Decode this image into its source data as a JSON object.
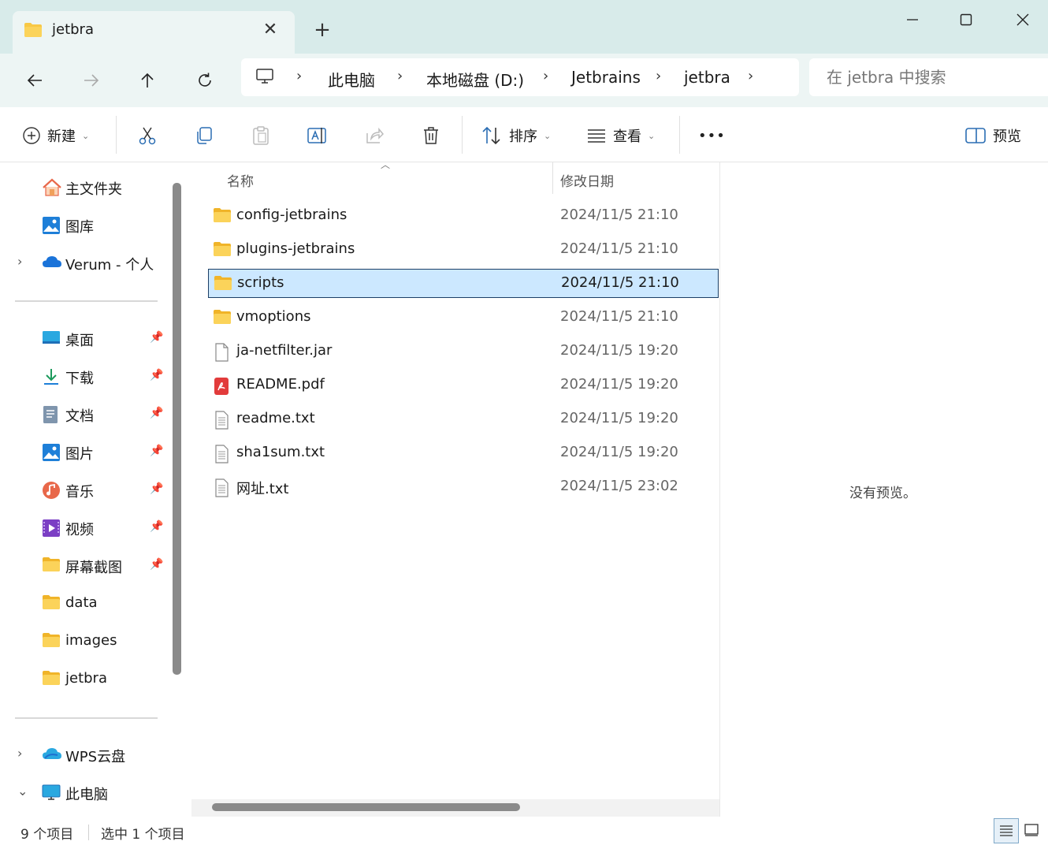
{
  "window": {
    "tab_title": "jetbra",
    "new_tab_symbol": "+"
  },
  "nav": {
    "breadcrumbs": [
      "此电脑",
      "本地磁盘 (D:)",
      "Jetbrains",
      "jetbra"
    ],
    "search_placeholder": "在 jetbra 中搜索"
  },
  "toolbar": {
    "new_label": "新建",
    "sort_label": "排序",
    "view_label": "查看",
    "more_label": "•••",
    "preview_label": "预览"
  },
  "sidebar": {
    "quick": [
      {
        "label": "主文件夹",
        "icon": "home-icon"
      },
      {
        "label": "图库",
        "icon": "gallery-icon"
      },
      {
        "label": "Verum - 个人",
        "icon": "onedrive-cloud-icon"
      }
    ],
    "pinned": [
      {
        "label": "桌面",
        "icon": "desktop-icon"
      },
      {
        "label": "下载",
        "icon": "download-icon"
      },
      {
        "label": "文档",
        "icon": "document-icon"
      },
      {
        "label": "图片",
        "icon": "pictures-icon"
      },
      {
        "label": "音乐",
        "icon": "music-icon"
      },
      {
        "label": "视频",
        "icon": "video-icon"
      },
      {
        "label": "屏幕截图",
        "icon": "folder-icon"
      },
      {
        "label": "data",
        "icon": "folder-icon"
      },
      {
        "label": "images",
        "icon": "folder-icon"
      },
      {
        "label": "jetbra",
        "icon": "folder-icon"
      }
    ],
    "bottom": [
      {
        "label": "WPS云盘",
        "icon": "wps-cloud-icon"
      },
      {
        "label": "此电脑",
        "icon": "this-pc-icon"
      }
    ]
  },
  "filelist": {
    "columns": {
      "name": "名称",
      "modified": "修改日期"
    },
    "rows": [
      {
        "name": "config-jetbrains",
        "date": "2024/11/5 21:10",
        "type": "folder"
      },
      {
        "name": "plugins-jetbrains",
        "date": "2024/11/5 21:10",
        "type": "folder"
      },
      {
        "name": "scripts",
        "date": "2024/11/5 21:10",
        "type": "folder",
        "selected": true
      },
      {
        "name": "vmoptions",
        "date": "2024/11/5 21:10",
        "type": "folder"
      },
      {
        "name": "ja-netfilter.jar",
        "date": "2024/11/5 19:20",
        "type": "file"
      },
      {
        "name": "README.pdf",
        "date": "2024/11/5 19:20",
        "type": "pdf"
      },
      {
        "name": "readme.txt",
        "date": "2024/11/5 19:20",
        "type": "text"
      },
      {
        "name": "sha1sum.txt",
        "date": "2024/11/5 19:20",
        "type": "text"
      },
      {
        "name": "网址.txt",
        "date": "2024/11/5 23:02",
        "type": "text"
      }
    ]
  },
  "preview": {
    "empty_text": "没有预览。"
  },
  "status": {
    "item_count": "9 个项目",
    "selected_count": "选中 1 个项目"
  },
  "colors": {
    "titlebar": "#d8ebea",
    "navbar": "#edf5f4",
    "selection": "#cce8ff",
    "folder": "#f8c845",
    "accent": "#0067c0"
  }
}
